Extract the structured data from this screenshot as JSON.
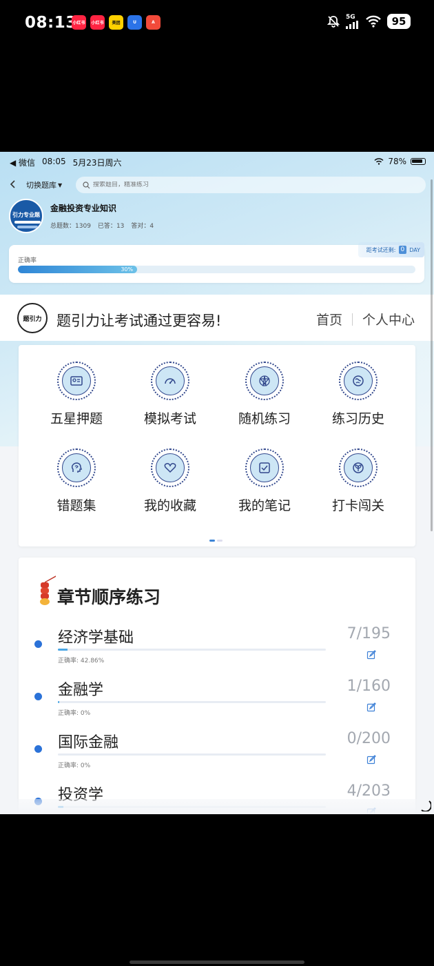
{
  "outer_status": {
    "time": "08:13",
    "apps": [
      {
        "name": "xiaohongshu-icon",
        "label": "小红书",
        "color": "#ff2442"
      },
      {
        "name": "xiaohongshu-icon-2",
        "label": "小红书",
        "color": "#ff2442"
      },
      {
        "name": "meituan-icon",
        "label": "美团",
        "color": "#ffd100"
      },
      {
        "name": "u-app-icon",
        "label": "U",
        "color": "#2b73e8"
      },
      {
        "name": "red-app-icon",
        "label": "A",
        "color": "#f24a3a"
      }
    ],
    "network": "5G",
    "battery": "95"
  },
  "inner_status": {
    "back_app": "◀ 微信",
    "time": "08:05",
    "date": "5月23日周六",
    "battery": "78%"
  },
  "top_nav": {
    "switch_label": "切换题库",
    "search_placeholder": "搜索题目，精准练习"
  },
  "bank": {
    "logo_text": "引力专业题",
    "name": "金融投资专业知识",
    "total_label": "总题数：",
    "total": "1309",
    "answered_label": "已答：",
    "answered": "13",
    "correct_label": "答对：",
    "correct": "4"
  },
  "rate_card": {
    "label": "正确率",
    "percent_text": "30%",
    "percent": 30,
    "countdown_label": "距考试还剩:",
    "countdown_value": "0",
    "countdown_unit": "DAY"
  },
  "brand": {
    "logo_text": "题引力",
    "slogan": "题引力让考试通过更容易!",
    "links": [
      "首页",
      "个人中心"
    ]
  },
  "grid": [
    {
      "label": "五星押题",
      "icon": "id-card-icon"
    },
    {
      "label": "模拟考试",
      "icon": "gauge-icon"
    },
    {
      "label": "随机练习",
      "icon": "random-star-icon"
    },
    {
      "label": "练习历史",
      "icon": "history-globe-icon"
    },
    {
      "label": "错题集",
      "icon": "head-brain-icon"
    },
    {
      "label": "我的收藏",
      "icon": "heart-icon"
    },
    {
      "label": "我的笔记",
      "icon": "note-check-icon"
    },
    {
      "label": "打卡闯关",
      "icon": "sprout-icon"
    }
  ],
  "chapter": {
    "title": "章节顺序练习",
    "items": [
      {
        "name": "经济学基础",
        "count": "7/195",
        "rate": "正确率: 42.86%",
        "progress": 0.036
      },
      {
        "name": "金融学",
        "count": "1/160",
        "rate": "正确率: 0%",
        "progress": 0.006
      },
      {
        "name": "国际金融",
        "count": "0/200",
        "rate": "正确率: 0%",
        "progress": 0
      },
      {
        "name": "投资学",
        "count": "4/203",
        "rate": "",
        "progress": 0.02
      }
    ]
  },
  "colors": {
    "accent": "#2b72d8",
    "icon_stroke": "#31478c",
    "icon_fill": "#cde6f5"
  }
}
